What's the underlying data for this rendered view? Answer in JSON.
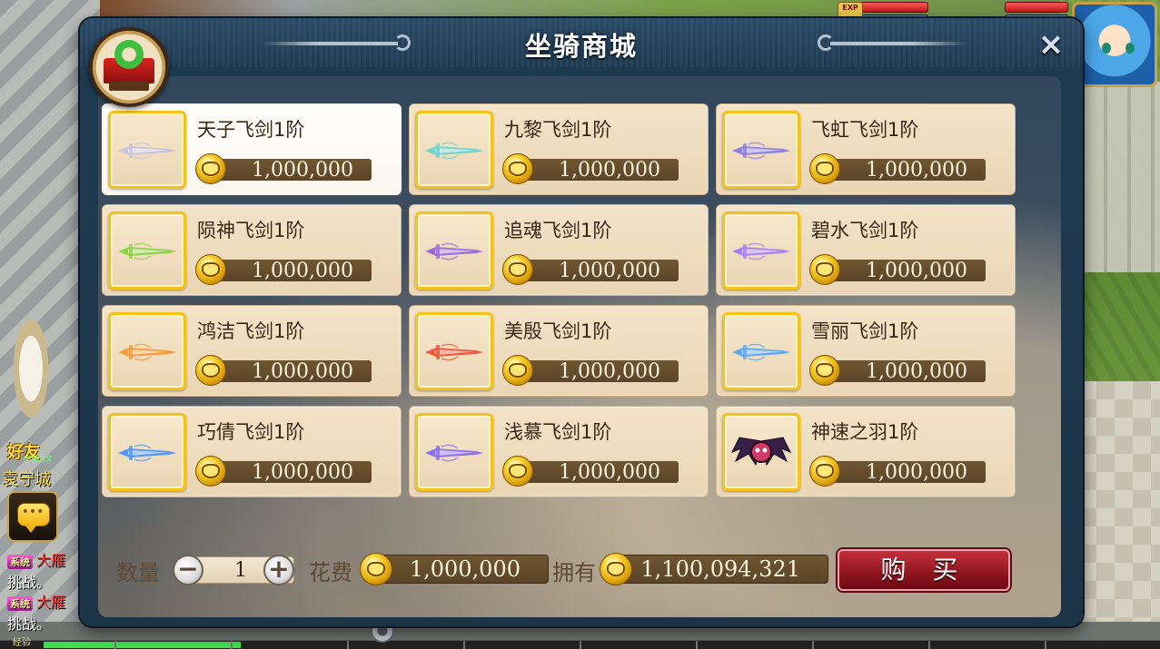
{
  "dialog": {
    "title": "坐骑商城",
    "close_label": "×"
  },
  "items": [
    {
      "name": "天子飞剑1阶",
      "price": "1,000,000",
      "icon": "sword-silver-icon",
      "color": "#c8c3d8",
      "selected": true
    },
    {
      "name": "九黎飞剑1阶",
      "price": "1,000,000",
      "icon": "sword-teal-icon",
      "color": "#6fd3c9"
    },
    {
      "name": "飞虹飞剑1阶",
      "price": "1,000,000",
      "icon": "sword-violet-icon",
      "color": "#8e7ce0"
    },
    {
      "name": "陨神飞剑1阶",
      "price": "1,000,000",
      "icon": "sword-green-icon",
      "color": "#8fd14a"
    },
    {
      "name": "追魂飞剑1阶",
      "price": "1,000,000",
      "icon": "sword-purple-icon",
      "color": "#9b6ad8"
    },
    {
      "name": "碧水飞剑1阶",
      "price": "1,000,000",
      "icon": "sword-lilac-icon",
      "color": "#a67ff0"
    },
    {
      "name": "鸿洁飞剑1阶",
      "price": "1,000,000",
      "icon": "sword-orange-icon",
      "color": "#f2993a"
    },
    {
      "name": "美殷飞剑1阶",
      "price": "1,000,000",
      "icon": "sword-red-icon",
      "color": "#e7553a"
    },
    {
      "name": "雪丽飞剑1阶",
      "price": "1,000,000",
      "icon": "sword-blue-orange-icon",
      "color": "#5aa7f0"
    },
    {
      "name": "巧倩飞剑1阶",
      "price": "1,000,000",
      "icon": "sword-blue-icon",
      "color": "#4f95f2"
    },
    {
      "name": "浅慕飞剑1阶",
      "price": "1,000,000",
      "icon": "sword-indigo-icon",
      "color": "#8a6de8"
    },
    {
      "name": "神速之羽1阶",
      "price": "1,000,000",
      "icon": "wing-demon-icon",
      "color": "#4a2a5a"
    }
  ],
  "footer": {
    "qty_label": "数量",
    "qty_value": "1",
    "minus_label": "−",
    "plus_label": "+",
    "cost_label": "花费",
    "cost_value": "1,000,000",
    "balance_label": "拥有",
    "balance_value": "1,100,094,321",
    "buy_label": "购 买"
  },
  "hud": {
    "friend_label": "好友",
    "friend_sub": "不可为文",
    "city_label": "袁守城",
    "exp_label": "经验",
    "exp_badge": "EXP",
    "exp_progress": 0.17
  },
  "system_log": [
    {
      "tag": "系统",
      "name": "大雁",
      "text": "挑战。"
    },
    {
      "tag": "系统",
      "name": "大雁",
      "text": "挑战。"
    }
  ]
}
